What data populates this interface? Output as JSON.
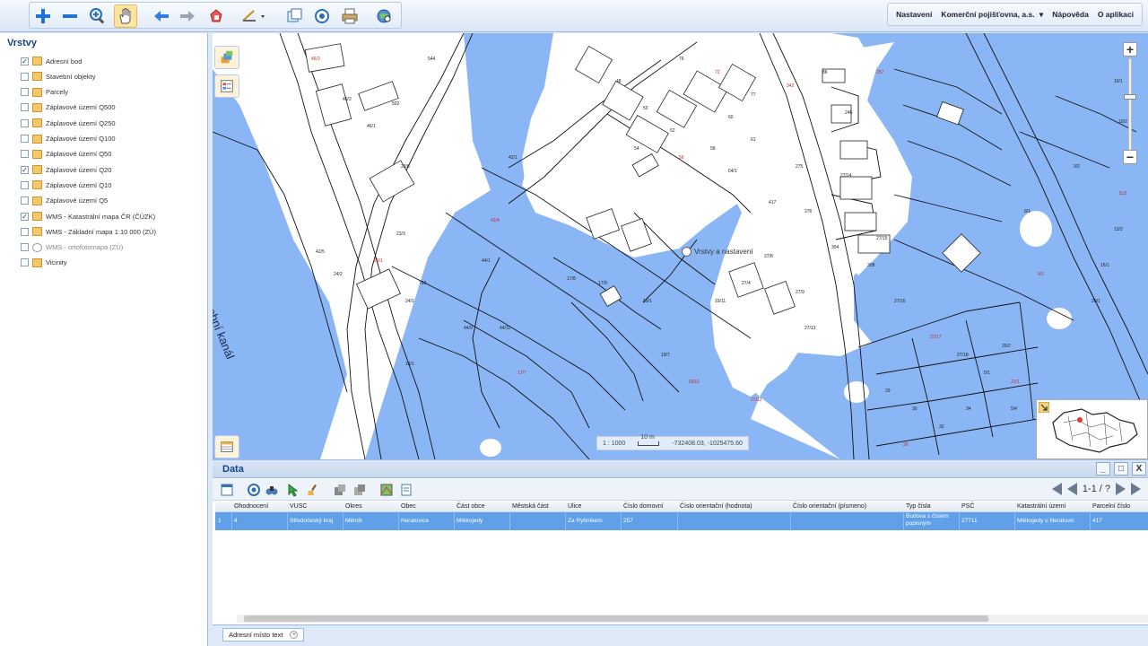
{
  "toolbar": {
    "tools": [
      "zoom-in-icon",
      "zoom-out-icon",
      "zoom-box-icon",
      "pan-hand-icon",
      "back-arrow-icon",
      "forward-arrow-icon",
      "select-shape-icon",
      "measure-icon",
      "layers-window-icon",
      "identify-icon",
      "print-icon",
      "search-globe-icon"
    ],
    "active_tool": "pan-hand-icon"
  },
  "top_menu": {
    "settings": "Nastavení",
    "company": "Komerční pojišťovna, a.s.",
    "help": "Nápověda",
    "about": "O aplikaci"
  },
  "layers_panel": {
    "title": "Vrstvy",
    "items": [
      {
        "label": "Adresní bod",
        "checked": true
      },
      {
        "label": "Stavební objekty",
        "checked": false
      },
      {
        "label": "Parcely",
        "checked": false
      },
      {
        "label": "Záplavové území Q500",
        "checked": false
      },
      {
        "label": "Záplavové území Q250",
        "checked": false
      },
      {
        "label": "Záplavové území Q100",
        "checked": false
      },
      {
        "label": "Záplavové území Q50",
        "checked": false
      },
      {
        "label": "Záplavové území Q20",
        "checked": true
      },
      {
        "label": "Záplavové území Q10",
        "checked": false
      },
      {
        "label": "Záplavové území Q5",
        "checked": false
      },
      {
        "label": "WMS - Katastrální mapa ČR (ČÚZK)",
        "checked": true
      },
      {
        "label": "WMS - Základní mapa 1:10 000 (ZÚ)",
        "checked": false
      },
      {
        "label": "WMS - ortofotomapa (ZÚ)",
        "checked": false
      },
      {
        "label": "Vicinity",
        "checked": false
      }
    ]
  },
  "map": {
    "canal_label": "plavební kanál",
    "tooltip": "Vrstvy a nastavení",
    "scale": "1 : 1000",
    "scale_bar": "10 m",
    "coordinates": "-732408.03, -1025475.60",
    "flood_color": "#8ab6f5",
    "parcel_labels": [
      "46/3",
      "46/2",
      "46/1",
      "23/6",
      "23/3",
      "23/1",
      "24/1",
      "24/2",
      "42/5",
      "42/1",
      "42/4",
      "44/1",
      "44/11",
      "44/9",
      "13/1",
      "17/7",
      "17/8",
      "17/9",
      "19/1",
      "19/7",
      "19/10",
      "19/11",
      "27/4",
      "27/8",
      "27/9",
      "27/12",
      "27/13",
      "27/14",
      "27/15",
      "27/16",
      "27/17",
      "27/18",
      "5/1",
      "5/4",
      "8/1",
      "9/1",
      "9/2",
      "10/1",
      "10/2",
      "10/3",
      "11/2",
      "13/2",
      "16/1",
      "20/1",
      "20/2",
      "21/1",
      "29",
      "30",
      "32",
      "34",
      "36",
      "48",
      "50",
      "52",
      "54",
      "56",
      "58",
      "60",
      "61",
      "64/1",
      "72",
      "76",
      "77",
      "86",
      "246",
      "257",
      "275",
      "276",
      "304",
      "308",
      "342",
      "417",
      "502",
      "544",
      "793"
    ]
  },
  "data_panel": {
    "title": "Data",
    "pager": "1-1 / ?",
    "columns": [
      "Ohodnocení",
      "VUSC",
      "Okres",
      "Obec",
      "Část obce",
      "Městská část",
      "Ulice",
      "Číslo domovní",
      "Číslo orientační (hodnota)",
      "Číslo orientační (písmeno)",
      "Typ čísla",
      "PSČ",
      "Katastrální území",
      "Parcelní číslo"
    ],
    "rows": [
      {
        "index": "1",
        "ohodnoceni": "4",
        "vusc": "Středočeský kraj",
        "okres": "Mělník",
        "obec": "Neratovice",
        "cast_obce": "Mlékojedy",
        "mestska_cast": "",
        "ulice": "Za Rybníkem",
        "cislo_domovni": "257",
        "co_hodnota": "",
        "co_pismeno": "",
        "typ_cisla_1": "Budova s číslem",
        "typ_cisla_2": "popisným",
        "psc": "27711",
        "katastralni_uzemi": "Mlékojedy u Neratovic",
        "parcelni_cislo": "417"
      }
    ]
  },
  "bottom_tab": {
    "label": "Adresní místo text"
  }
}
